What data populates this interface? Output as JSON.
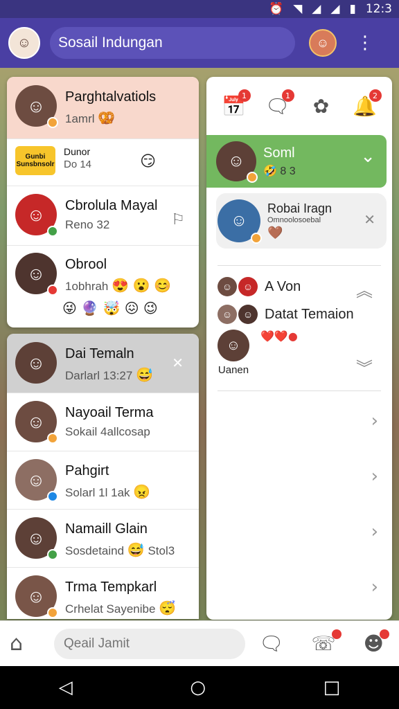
{
  "status": {
    "time": "12:3",
    "icons": [
      "alarm-icon",
      "wifi-icon",
      "signal-icon",
      "signal-icon",
      "battery-icon"
    ]
  },
  "appbar": {
    "title": "Sosail Indungan",
    "menu": "⋮"
  },
  "left_top": [
    {
      "name": "Parghtalvatiols",
      "sub": "1amrl",
      "emoji": "🥨",
      "bg": "#f8d8cc",
      "avatar_color": "#6d4c41",
      "badge": "#f2a33a"
    },
    {
      "logo": "Gunbi Sunsbnsolr",
      "name": "Dunor",
      "sub": "Do 14",
      "emoji": "😏",
      "bg": "#ffffff"
    },
    {
      "name": "Cbrolula Mayal",
      "sub": "Reno 32",
      "emoji": "",
      "bg": "#ffffff",
      "avatar_color": "#c62828",
      "badge": "#43a047",
      "flag": "⚐"
    },
    {
      "name": "Obrool",
      "sub": "1obhrah",
      "emoji": "😍 😮 😊",
      "emoji2": "😜 🔮 🤯 😖 😉",
      "bg": "#ffffff",
      "avatar_color": "#4e342e",
      "badge": "#e53935"
    }
  ],
  "left_bottom": [
    {
      "name": "Dai Temaln",
      "sub": "Darlarl 13:27",
      "emoji": "😅",
      "bg": "#d0d0d0",
      "close": "✕",
      "avatar_color": "#5d4037"
    },
    {
      "name": "Nayoail Terma",
      "sub": "Sokail 4allcosap",
      "emoji": "",
      "bg": "#ffffff",
      "avatar_color": "#6d4c41",
      "badge": "#f2a33a"
    },
    {
      "name": "Pahgirt",
      "sub": "Solarl 1l 1ak",
      "emoji": "😠",
      "bg": "#ffffff",
      "avatar_color": "#8d6e63",
      "badge": "#1e88e5"
    },
    {
      "name": "Namaill Glain",
      "sub": "Sosdetaind",
      "emoji": "😅",
      "extra": "Stol3",
      "bg": "#ffffff",
      "avatar_color": "#5d4037",
      "badge": "#43a047"
    },
    {
      "name": "Trma Tempkarl",
      "sub": "Crhelat Sayenibe",
      "emoji": "😴",
      "bg": "#ffffff",
      "avatar_color": "#795548",
      "badge": "#f2a33a"
    }
  ],
  "right_icons": [
    {
      "icon": "calendar-icon",
      "glyph": "📅",
      "badge": "1"
    },
    {
      "icon": "chat-icon",
      "glyph": "🗨",
      "badge": "1"
    },
    {
      "icon": "puzzle-icon",
      "glyph": "✿",
      "badge": ""
    },
    {
      "icon": "bell-icon",
      "glyph": "🔔",
      "badge": "2"
    }
  ],
  "right_list": {
    "highlight": {
      "name": "Soml",
      "sub": "🤣 8 3",
      "chevron": "⌄"
    },
    "item": {
      "name": "Robai Iragn",
      "sub": "Omnoolosoebal",
      "emoji": "🤎",
      "close": "✕"
    },
    "group": {
      "line1": "A Von",
      "line2": "Datat Temaion",
      "hearts": "❤️❤️●",
      "user": "Uanen"
    },
    "rows": [
      "›",
      "›",
      "›",
      "›"
    ]
  },
  "bottom": {
    "search_placeholder": "Qeail Jamit"
  },
  "colors": {
    "accent": "#4a3fa3",
    "highlight_green": "#73b85f",
    "badge_red": "#e53935"
  }
}
